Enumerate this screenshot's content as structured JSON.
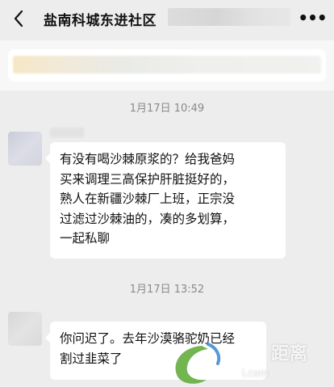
{
  "header": {
    "title": "盐南科城东进社区",
    "back_icon": "chevron-left-icon",
    "more_icon": "more-dots-icon",
    "more_label": "•••"
  },
  "messages": [
    {
      "timestamp": "1月17日 10:49",
      "text": "有没有喝沙棘原浆的？给我爸妈\n买来调理三高保护肝脏挺好的，\n熟人在新疆沙棘厂上班，正宗没\n过滤过沙棘油的，凑的多划算，\n一起私聊"
    },
    {
      "timestamp": "1月17日 13:52",
      "text": "你问迟了。去年沙漠骆驼奶已经\n割过韭菜了"
    }
  ],
  "watermark": {
    "text": "距离",
    "sub": "i.com"
  },
  "colors": {
    "background": "#ededed",
    "bubble": "#ffffff",
    "timestamp": "#8a8a8a",
    "watermark_green": "#5aa832",
    "watermark_blue": "#2a7fd0"
  }
}
